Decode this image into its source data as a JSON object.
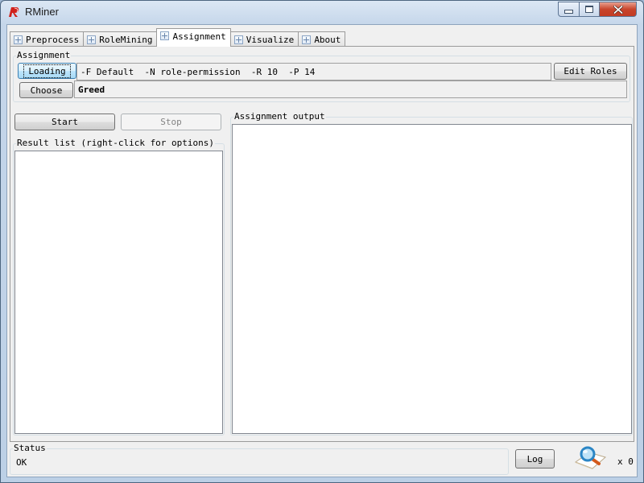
{
  "window": {
    "title": "RMiner",
    "controls": {
      "minimize": "minimize",
      "maximize": "maximize",
      "close": "close"
    }
  },
  "tabs": [
    {
      "label": "Preprocess",
      "active": false
    },
    {
      "label": "RoleMining",
      "active": false
    },
    {
      "label": "Assignment",
      "active": true
    },
    {
      "label": "Visualize",
      "active": false
    },
    {
      "label": "About",
      "active": false
    }
  ],
  "assignment": {
    "group_label": "Assignment",
    "loading_button": "Loading",
    "loading_params": "-F Default  -N role-permission  -R 10  -P 14",
    "edit_roles_button": "Edit Roles",
    "choose_button": "Choose",
    "choose_value": "Greed"
  },
  "controls": {
    "start_button": "Start",
    "stop_button": "Stop"
  },
  "result_list": {
    "label": "Result list (right-click for options)",
    "items": []
  },
  "output": {
    "label": "Assignment output",
    "text": ""
  },
  "status": {
    "label": "Status",
    "text": "OK",
    "log_button": "Log",
    "task_count": "x 0"
  },
  "colors": {
    "accent": "#3c7fb1",
    "close_button": "#c8452c",
    "logo": "#d0211b"
  }
}
